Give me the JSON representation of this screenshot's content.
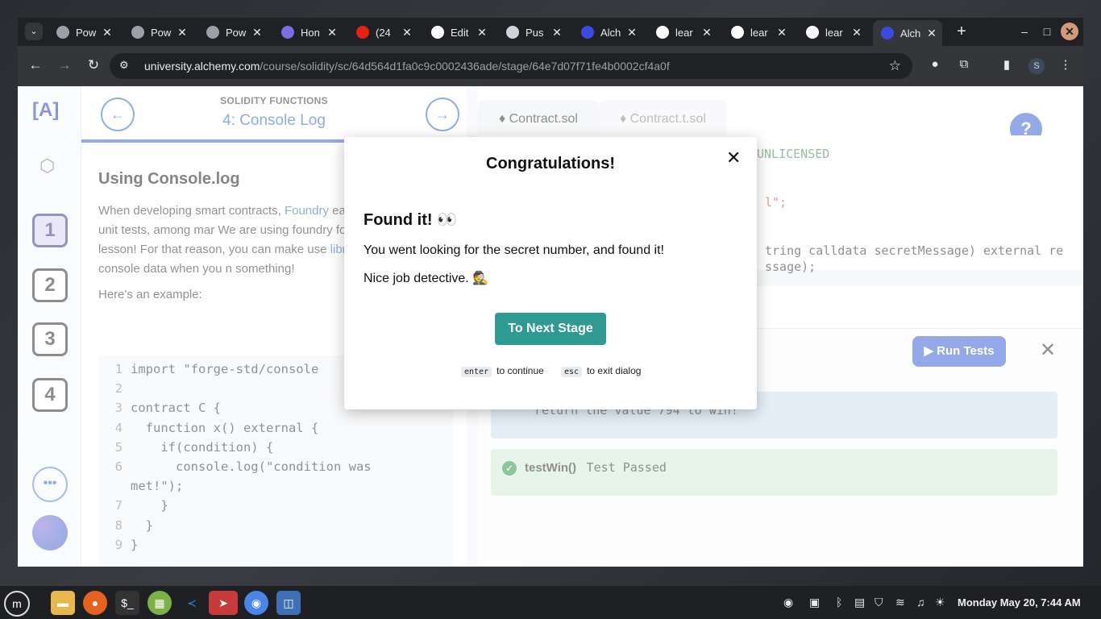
{
  "browser": {
    "tabs": [
      {
        "title": "Pow",
        "favicon": "globe-icon",
        "color": "#9aa0a6"
      },
      {
        "title": "Pow",
        "favicon": "globe-icon",
        "color": "#9aa0a6"
      },
      {
        "title": "Pow",
        "favicon": "globe-icon",
        "color": "#9aa0a6"
      },
      {
        "title": "Hon",
        "favicon": "cube-icon",
        "color": "#7b6ee0"
      },
      {
        "title": "(24",
        "favicon": "youtube-icon",
        "color": "#e62117"
      },
      {
        "title": "Edit",
        "favicon": "github-icon",
        "color": "#ffffff"
      },
      {
        "title": "Pus",
        "favicon": "pusher-icon",
        "color": "#cfd3da"
      },
      {
        "title": "Alch",
        "favicon": "alchemy-icon",
        "color": "#3b4be0"
      },
      {
        "title": "lear",
        "favicon": "github-icon",
        "color": "#ffffff"
      },
      {
        "title": "lear",
        "favicon": "github-icon",
        "color": "#ffffff"
      },
      {
        "title": "lear",
        "favicon": "github-icon",
        "color": "#ffffff"
      },
      {
        "title": "Alch",
        "favicon": "alchemy-icon",
        "color": "#3b4be0",
        "active": true
      }
    ],
    "url_host": "university.alchemy.com",
    "url_path": "/course/solidity/sc/64d564d1fa0c9c0002436ade/stage/64e7d07f71fe4b0002cf4a0f",
    "profile_initial": "S"
  },
  "page": {
    "logo": "[A]",
    "stages": [
      "1",
      "2",
      "3",
      "4"
    ],
    "current_stage": "1",
    "more_label": "•••",
    "lesson_kicker": "SOLIDITY FUNCTIONS",
    "lesson_title": "4: Console Log",
    "heading": "Using Console.log",
    "para_1a": "When developing smart contracts, ",
    "para_1_link": "Foundry",
    "para_1b": " easy to write Solidity unit tests, among mar We are using foundry for code execution in lesson! For that reason, you can make use ",
    "para_1_link2": "library",
    "para_1c": ", for logging console data when you n something!",
    "example_label": "Here's an example:",
    "code_lines": [
      {
        "n": "1",
        "text": "import \"forge-std/console"
      },
      {
        "n": "2",
        "text": ""
      },
      {
        "n": "3",
        "text": "contract C {"
      },
      {
        "n": "4",
        "text": "  function x() external {"
      },
      {
        "n": "5",
        "text": "    if(condition) {"
      },
      {
        "n": "6",
        "text": "      console.log(\"condition was"
      },
      {
        "n": "",
        "text": "met!\");"
      },
      {
        "n": "7",
        "text": "    }"
      },
      {
        "n": "8",
        "text": "  }"
      },
      {
        "n": "9",
        "text": "}"
      }
    ],
    "editor_tabs": [
      "Contract.sol",
      "Contract.t.sol"
    ],
    "help_label": "?",
    "editor_snippets": [
      "UNLICENSED",
      "l\";",
      "tring calldata secretMessage) external re",
      "ssage);"
    ],
    "run_tests_label": "Run Tests",
    "info_text": "return the value 794 to win!",
    "test_name": "testWin()",
    "test_status": "Test Passed"
  },
  "modal": {
    "title": "Congratulations!",
    "heading": "Found it! 👀",
    "message_1": "You went looking for the secret number, and found it!",
    "message_2": "Nice job detective. 🕵",
    "button_label": "To Next Stage",
    "hint_enter_key": "enter",
    "hint_enter_text": "to continue",
    "hint_esc_key": "esc",
    "hint_esc_text": "to exit dialog"
  },
  "taskbar": {
    "apps": [
      "mint-menu-icon",
      "files-icon",
      "firefox-icon",
      "terminal-icon",
      "calc-icon",
      "vscode-icon",
      "telegram-icon",
      "chrome-icon",
      "screenshot-icon"
    ],
    "clock": "Monday May 20, 7:44 AM"
  }
}
